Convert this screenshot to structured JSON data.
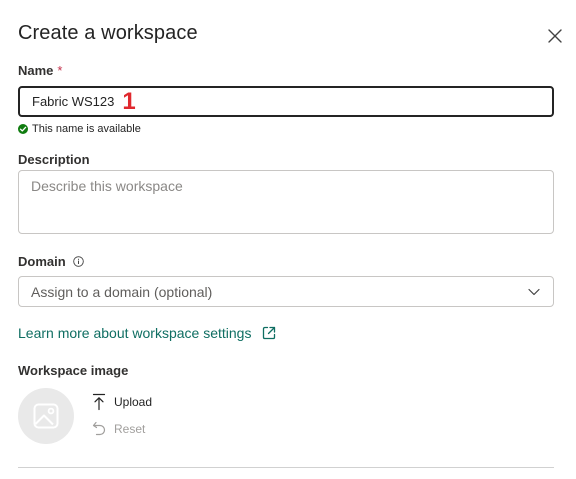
{
  "dialog": {
    "title": "Create a workspace"
  },
  "name_field": {
    "label": "Name",
    "required_mark": "*",
    "value": "Fabric WS123",
    "annotation": "1",
    "availability_text": "This name is available"
  },
  "description_field": {
    "label": "Description",
    "placeholder": "Describe this workspace"
  },
  "domain_field": {
    "label": "Domain",
    "selected": "Assign to a domain (optional)"
  },
  "learn_more": {
    "text": "Learn more about workspace settings"
  },
  "workspace_image": {
    "label": "Workspace image",
    "upload_label": "Upload",
    "reset_label": "Reset"
  },
  "colors": {
    "link": "#0f6e62",
    "success": "#107c10",
    "required": "#c4314b",
    "annotation": "#e0282e"
  },
  "icons": [
    "close-icon",
    "checkmark-icon",
    "info-icon",
    "chevron-down-icon",
    "external-link-icon",
    "image-icon",
    "upload-icon",
    "reset-icon"
  ]
}
